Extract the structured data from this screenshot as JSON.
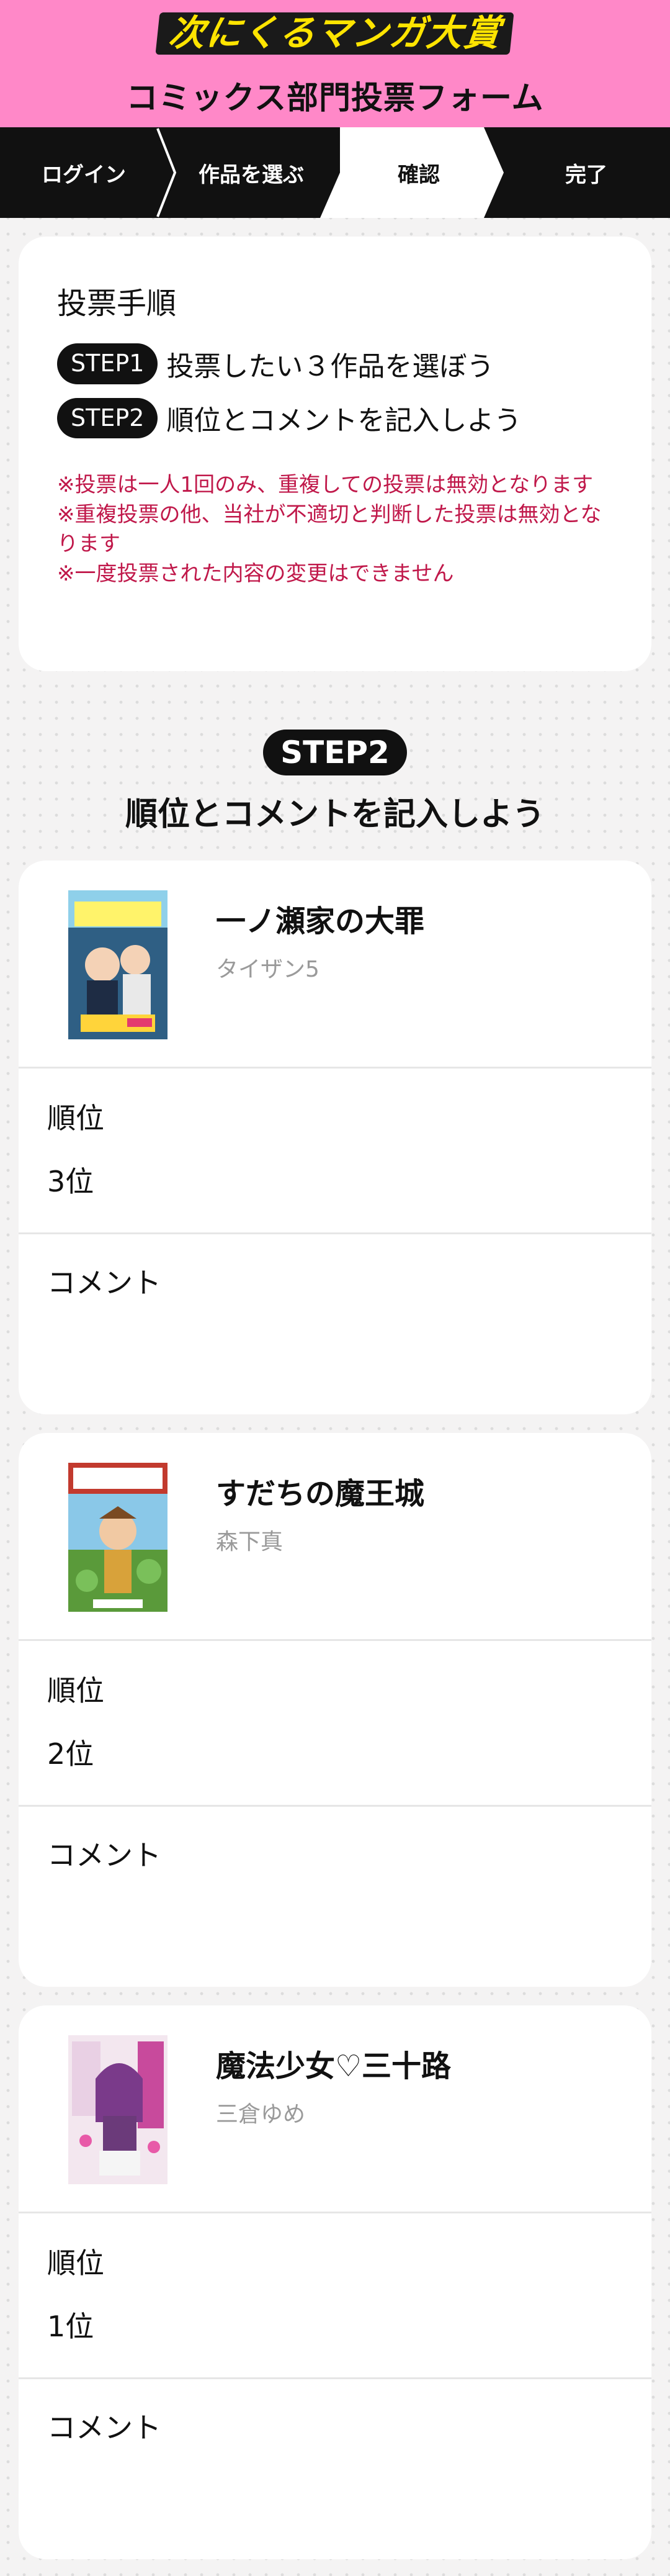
{
  "header": {
    "logo_text": "次にくるマンガ大賞",
    "form_title": "コミックス部門投票フォーム",
    "bg_color": "#ff88c8",
    "logo_color": "#ffe400"
  },
  "stepnav": {
    "steps": [
      {
        "label": "ログイン",
        "active": false
      },
      {
        "label": "作品を選ぶ",
        "active": false
      },
      {
        "label": "確認",
        "active": true
      },
      {
        "label": "完了",
        "active": false
      }
    ]
  },
  "instructions": {
    "title": "投票手順",
    "steps": [
      {
        "badge": "STEP1",
        "text": "投票したい３作品を選ぼう"
      },
      {
        "badge": "STEP2",
        "text": "順位とコメントを記入しよう"
      }
    ],
    "notes": [
      "※投票は一人1回のみ、重複しての投票は無効となります",
      "※重複投票の他、当社が不適切と判断した投票は無効となります",
      "※一度投票された内容の変更はできません"
    ],
    "note_color": "#c0184a"
  },
  "step2": {
    "badge": "STEP2",
    "title": "順位とコメントを記入しよう"
  },
  "works": [
    {
      "title": "一ノ瀬家の大罪",
      "author": "タイザン5",
      "rank_label": "順位",
      "rank_value": "3位",
      "comment_label": "コメント",
      "cover_icon": "cover-ichinose-icon"
    },
    {
      "title": "すだちの魔王城",
      "author": "森下真",
      "rank_label": "順位",
      "rank_value": "2位",
      "comment_label": "コメント",
      "cover_icon": "cover-sudachi-icon"
    },
    {
      "title": "魔法少女♡三十路",
      "author": "三倉ゆめ",
      "rank_label": "順位",
      "rank_value": "1位",
      "comment_label": "コメント",
      "cover_icon": "cover-mahou-icon"
    }
  ]
}
